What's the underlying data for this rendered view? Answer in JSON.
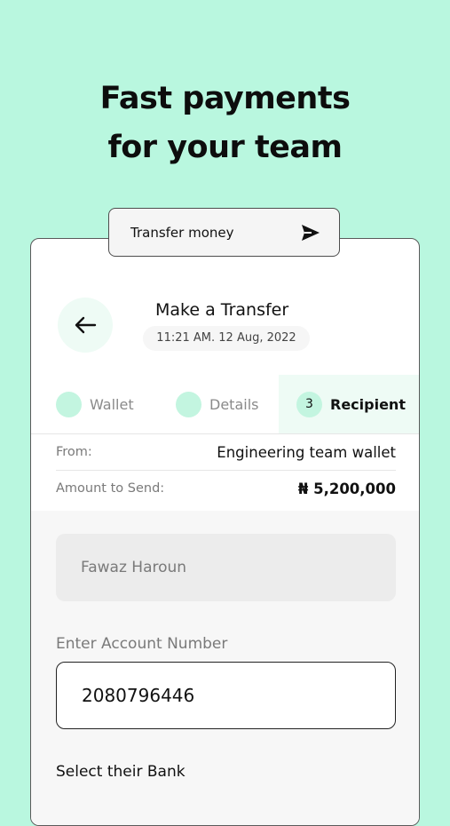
{
  "headline": {
    "line1": "Fast payments",
    "line2": "for your team"
  },
  "action_pill": {
    "label": "Transfer money",
    "icon": "send-icon"
  },
  "header": {
    "title": "Make a Transfer",
    "datetime": "11:21 AM.  12 Aug, 2022",
    "back_icon": "arrow-left-icon"
  },
  "steps": [
    {
      "number": "",
      "label": "Wallet",
      "active": false
    },
    {
      "number": "",
      "label": "Details",
      "active": false
    },
    {
      "number": "3",
      "label": "Recipient",
      "active": true
    }
  ],
  "summary": {
    "from_label": "From:",
    "from_value": "Engineering team wallet",
    "amount_label": "Amount to Send:",
    "amount_value": "₦ 5,200,000"
  },
  "form": {
    "recipient_name": "Fawaz Haroun",
    "account_label": "Enter Account Number",
    "account_value": "2080796446",
    "bank_label": "Select their Bank"
  },
  "colors": {
    "background": "#b9f7df",
    "accent_light": "#c3f5e0",
    "active_step_bg": "#eefbf5"
  }
}
